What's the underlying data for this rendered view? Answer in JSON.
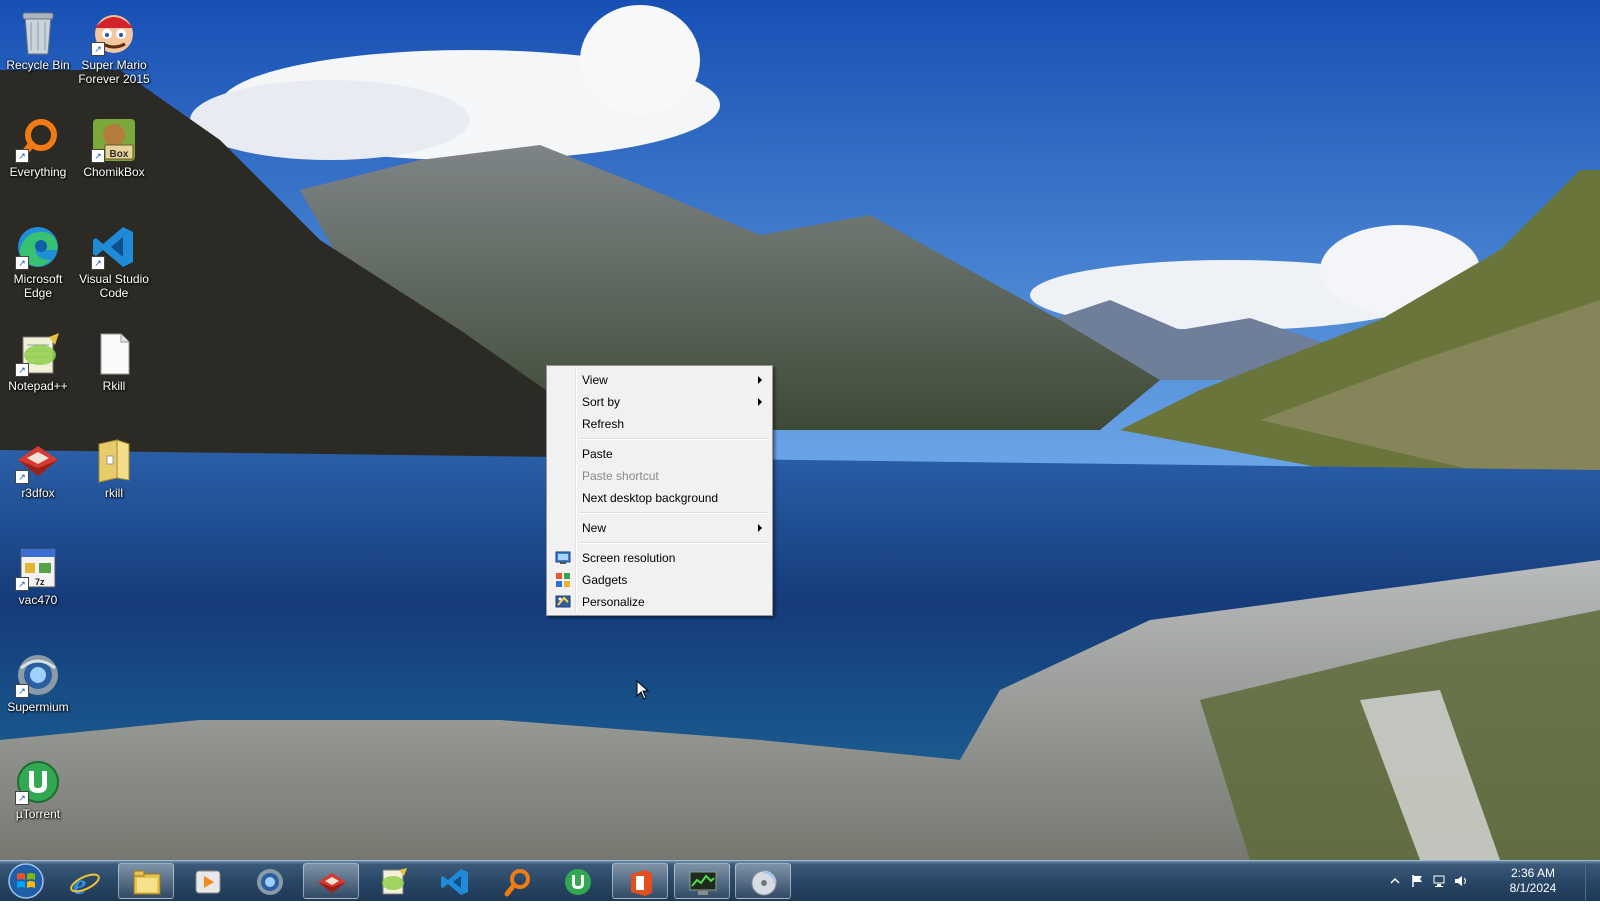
{
  "desktop_icons": [
    {
      "label": "Recycle Bin",
      "icon": "recycle-bin-icon"
    },
    {
      "label": "Super Mario Forever 2015",
      "icon": "mario-icon"
    },
    {
      "label": "Everything",
      "icon": "everything-search-icon"
    },
    {
      "label": "ChomikBox",
      "icon": "chomikbox-icon"
    },
    {
      "label": "Microsoft Edge",
      "icon": "edge-icon"
    },
    {
      "label": "Visual Studio Code",
      "icon": "vscode-icon"
    },
    {
      "label": "Notepad++",
      "icon": "notepadpp-icon"
    },
    {
      "label": "Rkill",
      "icon": "file-icon"
    },
    {
      "label": "r3dfox",
      "icon": "r3dfox-icon"
    },
    {
      "label": "rkill",
      "icon": "folder-icon"
    },
    {
      "label": "vac470",
      "icon": "installer-icon"
    },
    {
      "label": "Supermium",
      "icon": "supermium-icon"
    },
    {
      "label": "µTorrent",
      "icon": "utorrent-icon"
    }
  ],
  "context_menu": {
    "items": [
      {
        "label": "View",
        "submenu": true
      },
      {
        "label": "Sort by",
        "submenu": true
      },
      {
        "label": "Refresh"
      },
      {
        "label": "Paste"
      },
      {
        "label": "Paste shortcut",
        "disabled": true
      },
      {
        "label": "Next desktop background"
      },
      {
        "label": "New",
        "submenu": true
      },
      {
        "label": "Screen resolution",
        "icon": "screen-resolution-icon"
      },
      {
        "label": "Gadgets",
        "icon": "gadgets-icon"
      },
      {
        "label": "Personalize",
        "icon": "personalize-icon"
      }
    ]
  },
  "taskbar": {
    "start_icon": "windows-start-icon",
    "buttons": [
      {
        "icon": "internet-explorer-icon",
        "state": "pinned"
      },
      {
        "icon": "file-explorer-icon",
        "state": "running"
      },
      {
        "icon": "media-player-icon",
        "state": "pinned"
      },
      {
        "icon": "supermium-icon",
        "state": "pinned"
      },
      {
        "icon": "r3dfox-icon",
        "state": "running"
      },
      {
        "icon": "notepadpp-icon",
        "state": "pinned"
      },
      {
        "icon": "vscode-icon",
        "state": "pinned"
      },
      {
        "icon": "everything-search-icon",
        "state": "pinned"
      },
      {
        "icon": "utorrent-icon",
        "state": "pinned"
      },
      {
        "icon": "office-icon",
        "state": "running"
      },
      {
        "icon": "task-manager-icon",
        "state": "running"
      },
      {
        "icon": "disc-icon",
        "state": "running"
      }
    ],
    "tray": {
      "icons": [
        "show-hidden-icons-chevron",
        "action-center-flag-icon",
        "network-icon",
        "volume-icon"
      ],
      "time": "2:36 AM",
      "date": "8/1/2024"
    }
  },
  "colors": {
    "sky": "#2a68c9",
    "lake": "#143a78",
    "menu_bg": "#f1f1f1",
    "taskbar": "#2a4766"
  }
}
